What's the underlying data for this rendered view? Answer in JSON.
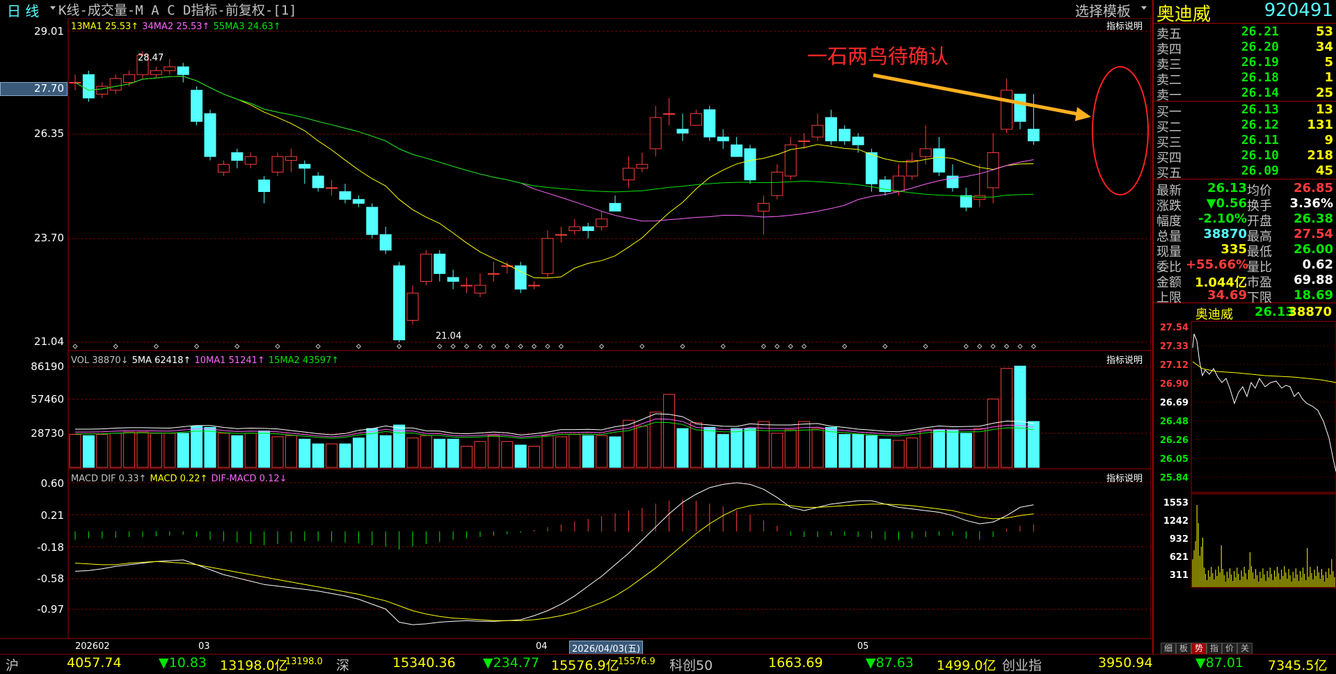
{
  "header": {
    "period": "日 线",
    "title": "K线-成交量-M A C D指标-前复权-[1]",
    "template_btn": "选择模板",
    "stock_name": "奥迪威",
    "stock_code": "920491"
  },
  "kline": {
    "legend": [
      {
        "text": "13MA1 25.53↑",
        "color": "#ffff00"
      },
      {
        "text": "34MA2 25.53↑",
        "color": "#ff66ff"
      },
      {
        "text": "55MA3 24.63↑",
        "color": "#00e600"
      }
    ],
    "help": "指标说明",
    "yticks": [
      "29.01",
      "27.70",
      "26.35",
      "23.70",
      "21.04"
    ],
    "high_label": "28.47",
    "low_label": "21.04",
    "annotation": "一石两鸟待确认",
    "current_price_label": "27.70"
  },
  "volume": {
    "legend": [
      {
        "text": "VOL 38870↓",
        "color": "#c0c0c0"
      },
      {
        "text": "5MA 62418↑",
        "color": "#ffffff"
      },
      {
        "text": "10MA1 51241↑",
        "color": "#ff66ff"
      },
      {
        "text": "15MA2 43597↑",
        "color": "#00e600"
      }
    ],
    "help": "指标说明",
    "yticks": [
      "86190",
      "57460",
      "28730"
    ]
  },
  "macd": {
    "legend": [
      {
        "text": "MACD DIF 0.33↑",
        "color": "#c0c0c0"
      },
      {
        "text": "MACD 0.22↑",
        "color": "#ffff00"
      },
      {
        "text": "DIF-MACD 0.12↓",
        "color": "#ff66ff"
      }
    ],
    "help": "指标说明",
    "yticks": [
      "0.60",
      "0.21",
      "-0.18",
      "-0.58",
      "-0.97"
    ]
  },
  "xaxis": {
    "labels": [
      "202602",
      "03",
      "04",
      "05"
    ],
    "cursor_date": "2026/04/03(五)"
  },
  "orderbook": {
    "asks": [
      {
        "name": "卖五",
        "price": "26.21",
        "vol": "53"
      },
      {
        "name": "卖四",
        "price": "26.20",
        "vol": "34"
      },
      {
        "name": "卖三",
        "price": "26.19",
        "vol": "5"
      },
      {
        "name": "卖二",
        "price": "26.18",
        "vol": "1"
      },
      {
        "name": "卖一",
        "price": "26.14",
        "vol": "25"
      }
    ],
    "bids": [
      {
        "name": "买一",
        "price": "26.13",
        "vol": "13"
      },
      {
        "name": "买二",
        "price": "26.12",
        "vol": "131"
      },
      {
        "name": "买三",
        "price": "26.11",
        "vol": "9"
      },
      {
        "name": "买四",
        "price": "26.10",
        "vol": "218"
      },
      {
        "name": "买五",
        "price": "26.09",
        "vol": "45"
      }
    ]
  },
  "quote": [
    {
      "n1": "最新",
      "v1": "26.13",
      "c1": "#00e600",
      "n2": "均价",
      "v2": "26.85",
      "c2": "#ff3b3b"
    },
    {
      "n1": "涨跌",
      "v1": "▼0.56",
      "c1": "#00e600",
      "n2": "换手",
      "v2": "3.36%",
      "c2": "#ffffff"
    },
    {
      "n1": "幅度",
      "v1": "-2.10%",
      "c1": "#00e600",
      "n2": "开盘",
      "v2": "26.38",
      "c2": "#00e600"
    },
    {
      "n1": "总量",
      "v1": "38870",
      "c1": "#54ffff",
      "n2": "最高",
      "v2": "27.54",
      "c2": "#ff3b3b"
    },
    {
      "n1": "现量",
      "v1": "335",
      "c1": "#ffff00",
      "n2": "最低",
      "v2": "26.00",
      "c2": "#00e600"
    },
    {
      "n1": "委比",
      "v1": "+55.66%",
      "c1": "#ff3b3b",
      "n2": "量比",
      "v2": "0.62",
      "c2": "#ffffff"
    },
    {
      "n1": "金额",
      "v1": "1.044亿",
      "c1": "#ffff00",
      "n2": "市盈",
      "v2": "69.88",
      "c2": "#ffffff"
    },
    {
      "n1": "上限",
      "v1": "34.69",
      "c1": "#ff3b3b",
      "n2": "下限",
      "v2": "18.69",
      "c2": "#00e600"
    }
  ],
  "intraday": {
    "name": "奥迪威",
    "price": "26.13",
    "volume": "38870",
    "yticks": [
      "27.54",
      "27.33",
      "27.12",
      "26.90",
      "26.69",
      "26.48",
      "26.26",
      "26.05",
      "25.84"
    ],
    "vticks": [
      "1553",
      "1242",
      "932",
      "621",
      "311"
    ]
  },
  "tabs": [
    "细",
    "板",
    "势",
    "指",
    "价",
    "关"
  ],
  "status": [
    {
      "name": "沪",
      "val": "4057.74",
      "chg": "▼10.83",
      "amt": "13198.0亿",
      "amt2": "13198.0"
    },
    {
      "name": "深",
      "val": "15340.36",
      "chg": "▼234.77",
      "amt": "15576.9亿",
      "amt2": "15576.9"
    },
    {
      "name": "科创50",
      "val": "1663.69",
      "chg": "▼87.63",
      "amt": "1499.0亿"
    },
    {
      "name": "创业指",
      "val": "3950.94",
      "chg": "▼87.01",
      "amt": "7345.5亿"
    }
  ]
}
